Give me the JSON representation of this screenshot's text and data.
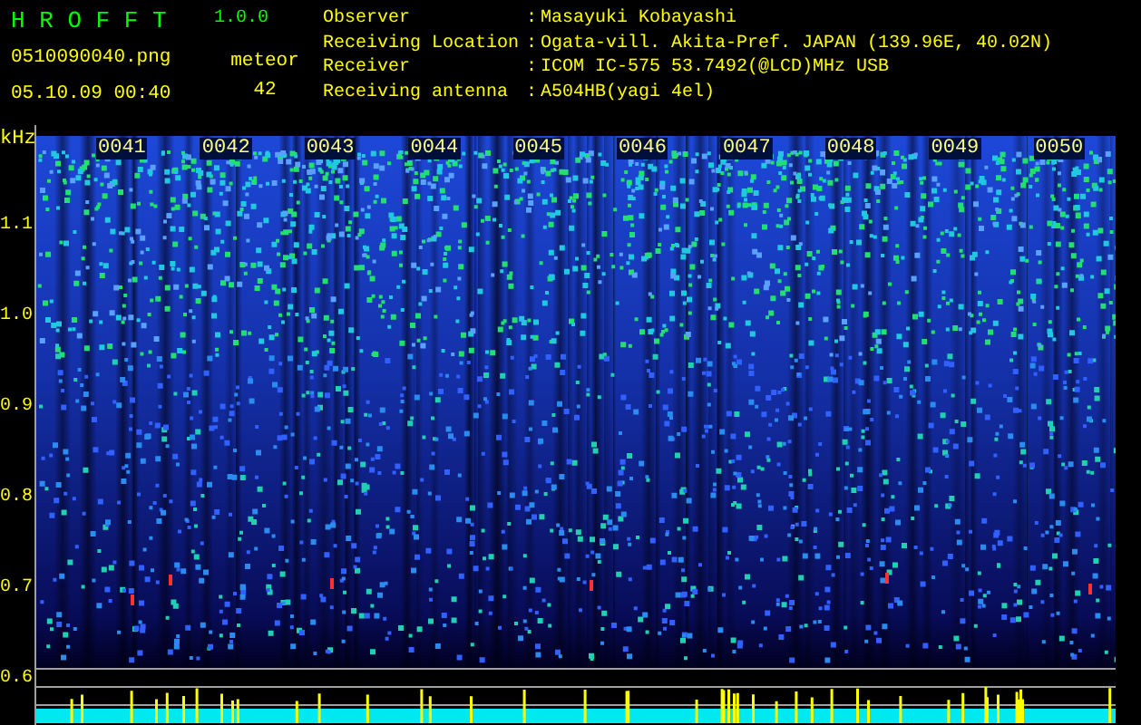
{
  "app": {
    "title": "H R O F F T",
    "version": "1.0.0"
  },
  "file": {
    "name": "0510090040.png",
    "datetime": "05.10.09 00:40"
  },
  "counter": {
    "label": "meteor",
    "value": "42"
  },
  "station": [
    {
      "label": "Observer",
      "separator": ":",
      "value": "Masayuki Kobayashi"
    },
    {
      "label": "Receiving Location",
      "separator": ":",
      "value": "Ogata-vill. Akita-Pref. JAPAN (139.96E, 40.02N)"
    },
    {
      "label": "Receiver",
      "separator": ":",
      "value": "ICOM IC-575 53.7492(@LCD)MHz USB"
    },
    {
      "label": "Receiving antenna",
      "separator": ":",
      "value": "A504HB(yagi 4el)"
    }
  ],
  "spectrogram": {
    "unit": "kHz",
    "y_labels": [
      "1.1",
      "1.0",
      "0.9",
      "0.8",
      "0.7",
      "0.6"
    ],
    "time_labels": [
      "0041",
      "0042",
      "0043",
      "0044",
      "0045",
      "0046",
      "0047",
      "0048",
      "0049",
      "0050"
    ]
  }
}
